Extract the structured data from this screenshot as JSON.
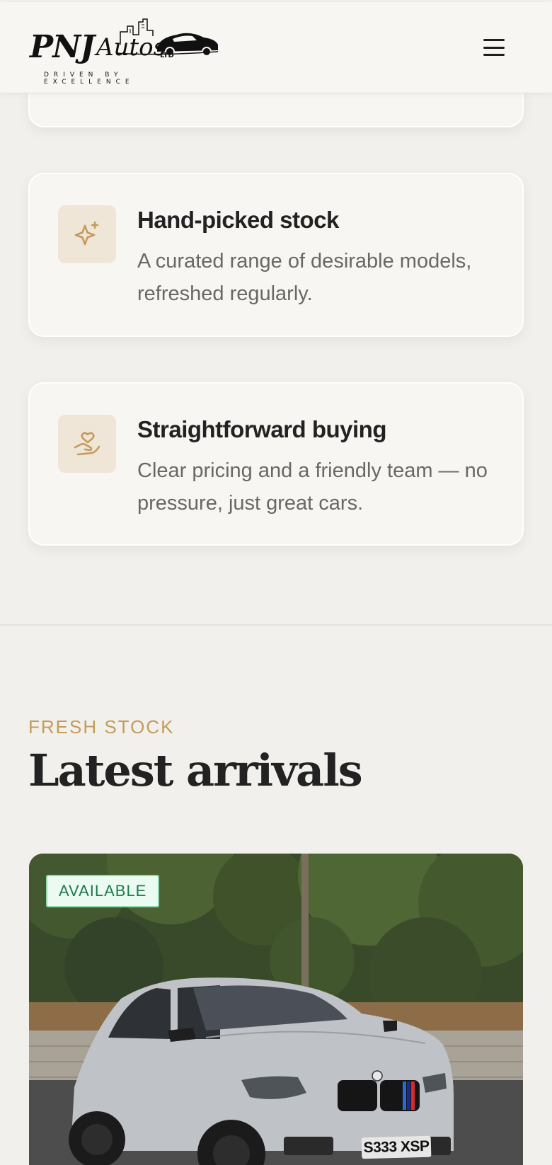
{
  "header": {
    "logo": {
      "main": "PNJ",
      "script": "Autos",
      "ltd": "LTD",
      "tagline": "DRIVEN BY EXCELLENCE"
    },
    "menu_icon": "hamburger-menu-icon"
  },
  "features": [
    {
      "icon": "sparkle-icon",
      "title": "Hand-picked stock",
      "text": "A curated range of desirable models, refreshed regularly."
    },
    {
      "icon": "hand-heart-icon",
      "title": "Straightforward buying",
      "text": "Clear pricing and a friendly team — no pressure, just great cars."
    }
  ],
  "arrivals": {
    "eyebrow": "FRESH STOCK",
    "title": "Latest arrivals",
    "cars": [
      {
        "status": "AVAILABLE",
        "plate": "S333 XSP"
      }
    ]
  },
  "colors": {
    "accent": "#c49b5a",
    "background": "#f2f0ec",
    "available_text": "#1d7a48"
  }
}
